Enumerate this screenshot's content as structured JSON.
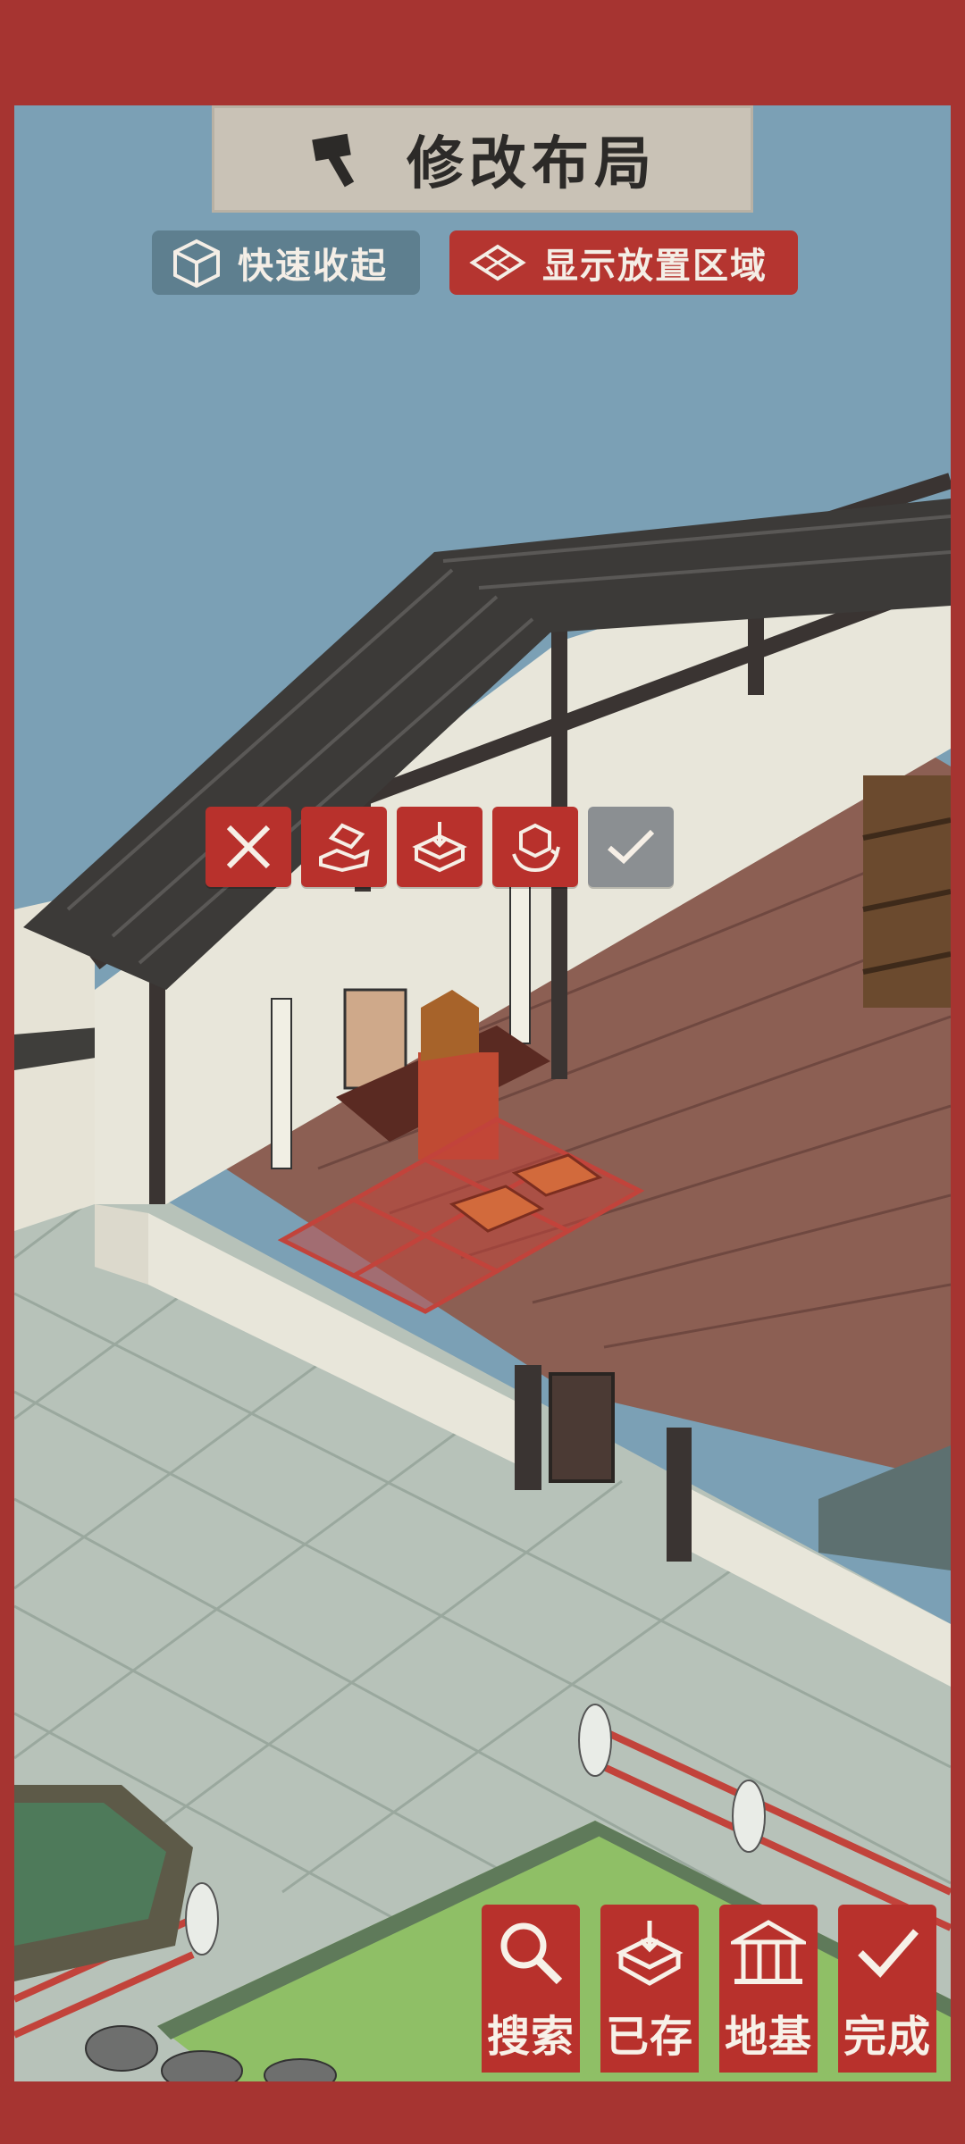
{
  "header": {
    "title": "修改布局",
    "title_icon": "hammer-icon"
  },
  "quick_actions": {
    "collapse_label": "快速收起",
    "collapse_icon": "box-icon",
    "show_area_label": "显示放置区域",
    "show_area_icon": "grid-icon"
  },
  "item_actions": [
    {
      "name": "remove",
      "icon": "close-icon"
    },
    {
      "name": "store",
      "icon": "store-hand-icon"
    },
    {
      "name": "put-in-storage",
      "icon": "box-download-icon"
    },
    {
      "name": "rotate",
      "icon": "rotate-box-icon"
    },
    {
      "name": "confirm",
      "icon": "check-icon"
    }
  ],
  "toolbar": {
    "search_label": "搜索",
    "saved_label": "已存",
    "foundation_label": "地基",
    "done_label": "完成"
  },
  "colors": {
    "frame": "#a63431",
    "action_red": "#b8312c",
    "confirm_gray": "#8b8f92",
    "collapse_blue": "#5e7f8f",
    "banner": "#c9c2b6"
  }
}
